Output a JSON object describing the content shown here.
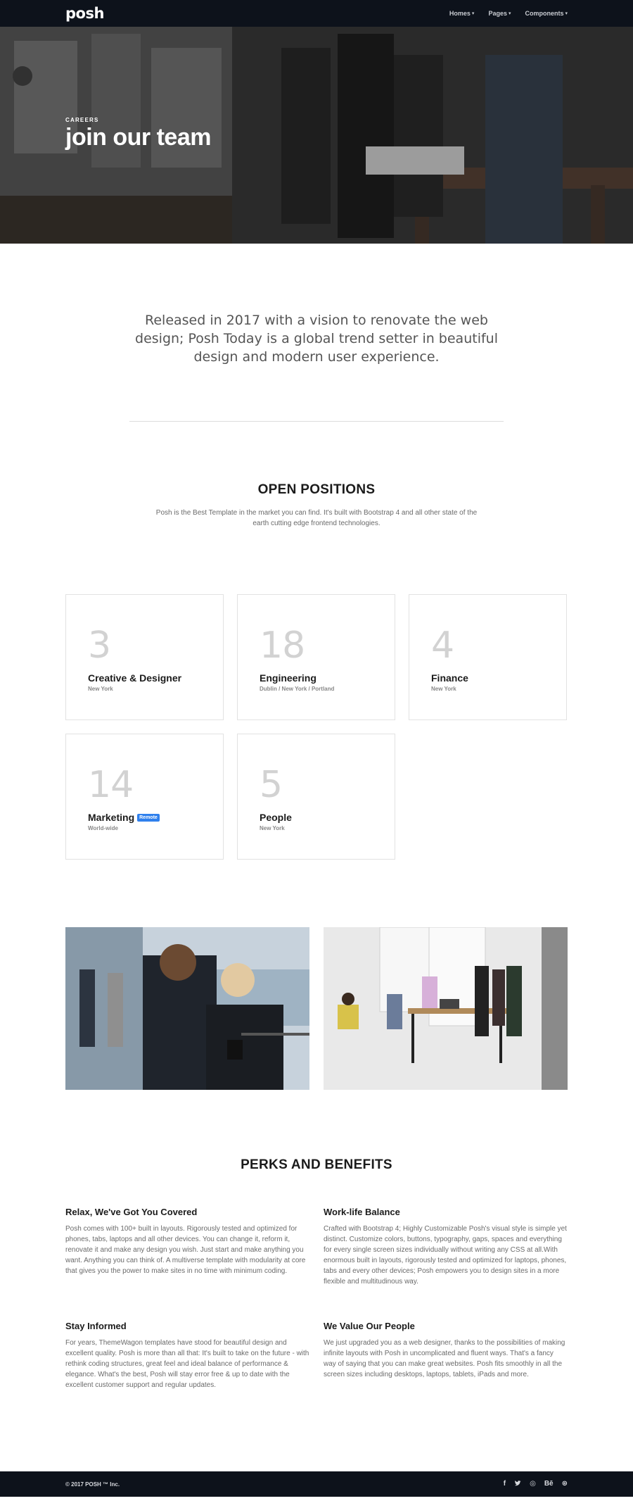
{
  "nav": {
    "logo": "posh",
    "items": [
      {
        "label": "Homes"
      },
      {
        "label": "Pages"
      },
      {
        "label": "Components"
      }
    ]
  },
  "hero": {
    "subtitle": "CAREERS",
    "title": "join our team"
  },
  "intro": {
    "text": "Released in 2017 with a vision to renovate the web design; Posh Today is a global trend setter in beautiful design and modern user experience."
  },
  "positions": {
    "title": "OPEN POSITIONS",
    "description": "Posh is the Best Template in the market you can find. It's built with Bootstrap 4 and all other state of the earth cutting edge frontend technologies.",
    "cards": [
      {
        "count": "3",
        "title": "Creative & Designer",
        "location": "New York",
        "badge": ""
      },
      {
        "count": "18",
        "title": "Engineering",
        "location": "Dublin / New York / Portland",
        "badge": ""
      },
      {
        "count": "4",
        "title": "Finance",
        "location": "New York",
        "badge": ""
      },
      {
        "count": "14",
        "title": "Marketing",
        "location": "World-wide",
        "badge": "Remote"
      },
      {
        "count": "5",
        "title": "People",
        "location": "New York",
        "badge": ""
      }
    ]
  },
  "perks": {
    "title": "PERKS AND BENEFITS",
    "items": [
      {
        "title": "Relax, We've Got You Covered",
        "text": "Posh comes with 100+ built in layouts. Rigorously tested and optimized for phones, tabs, laptops and all other devices. You can change it, reform it, renovate it and make any design you wish. Just start and make anything you want. Anything you can think of. A multiverse template with modularity at core that gives you the power to make sites in no time with minimum coding."
      },
      {
        "title": "Work-life Balance",
        "text": "Crafted with Bootstrap 4; Highly Customizable Posh's visual style is simple yet distinct. Customize colors, buttons, typography, gaps, spaces and everything for every single screen sizes individually without writing any CSS at all.With enormous built in layouts, rigorously tested and optimized for laptops, phones, tabs and every other devices; Posh empowers you to design sites in a more flexible and multitudinous way."
      },
      {
        "title": "Stay Informed",
        "text": "For years, ThemeWagon templates have stood for beautiful design and excellent quality. Posh is more than all that: It's built to take on the future - with rethink coding structures, great feel and ideal balance of performance & elegance. What's the best, Posh will stay error free & up to date with the excellent customer support and regular updates."
      },
      {
        "title": "We Value Our People",
        "text": "We just upgraded you as a web designer, thanks to the possibilities of making infinite layouts with Posh in uncomplicated and fluent ways. That's a fancy way of saying that you can make great websites. Posh fits smoothly in all the screen sizes including desktops, laptops, tablets, iPads and more."
      }
    ]
  },
  "footer": {
    "copyright": "© 2017 POSH ™ Inc.",
    "social": [
      {
        "icon": "facebook-icon",
        "glyph": "f"
      },
      {
        "icon": "twitter-icon",
        "glyph": "🐦"
      },
      {
        "icon": "instagram-icon",
        "glyph": "◎"
      },
      {
        "icon": "behance-icon",
        "glyph": "Bē"
      },
      {
        "icon": "dribbble-icon",
        "glyph": "⊛"
      }
    ]
  },
  "colors": {
    "nav_bg": "#0d121b",
    "badge": "#2f80ed",
    "heading": "#1b1b1b",
    "body_text": "#6a6a6a"
  }
}
